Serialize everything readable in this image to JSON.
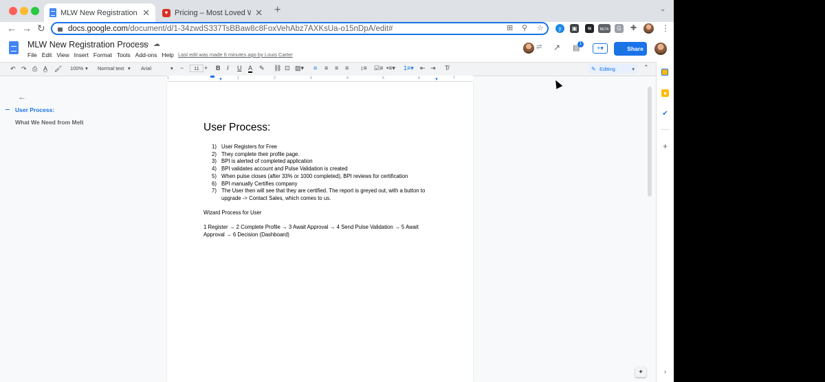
{
  "browser": {
    "tabs": [
      {
        "title": "MLW New Registration Proces",
        "active": true
      },
      {
        "title": "Pricing – Most Loved Workplac",
        "active": false
      }
    ],
    "new_tab": "+",
    "url_host": "docs.google.com",
    "url_path": "/document/d/1-34zwdS337TsBBaw8c8FoxVehAbz7AXKsUa-o15nDpA/edit#",
    "ext_beta": "BETA",
    "ext_g": "G"
  },
  "docs": {
    "title": "MLW New Registration Process",
    "menu": [
      "File",
      "Edit",
      "View",
      "Insert",
      "Format",
      "Tools",
      "Add-ons",
      "Help"
    ],
    "last_edit": "Last edit was made 6 minutes ago by Louis Carter",
    "share_label": "Share",
    "comments_badge": "1"
  },
  "format_toolbar": {
    "zoom": "100%",
    "style": "Normal text",
    "font": "Arial",
    "size": "11",
    "mode": "Editing"
  },
  "ruler": [
    "1",
    "1",
    "2",
    "3",
    "4",
    "5",
    "6",
    "7"
  ],
  "outline": {
    "items": [
      {
        "label": "User Process:",
        "active": true
      },
      {
        "label": "What We Need from Melt",
        "active": false
      }
    ]
  },
  "document": {
    "heading": "User Process:",
    "steps": [
      {
        "n": "1)",
        "text": "User Registers for Free"
      },
      {
        "n": "2)",
        "text": "They complete their profile page."
      },
      {
        "n": "3)",
        "text": "BPI is alerted of completed application"
      },
      {
        "n": "4)",
        "text": "BPI validates account and Pulse Validation is created"
      },
      {
        "n": "5)",
        "text": "When pulse closes (after 33% or 1000 completed), BPI reviews for certification"
      },
      {
        "n": "6)",
        "text": "BPI manually Certifies company"
      },
      {
        "n": "7)",
        "text": "The User then will see that they are certified. The report is greyed out, with a button to upgrade -> Contact Sales, which comes to us."
      }
    ],
    "wizard_heading": "Wizard Process for User",
    "wizard_flow": "1 Register →  2 Complete Profile → 3 Await Approval → 4 Send Pulse Validation → 5 Await Approval → 6 Decision (Dashboard)"
  }
}
